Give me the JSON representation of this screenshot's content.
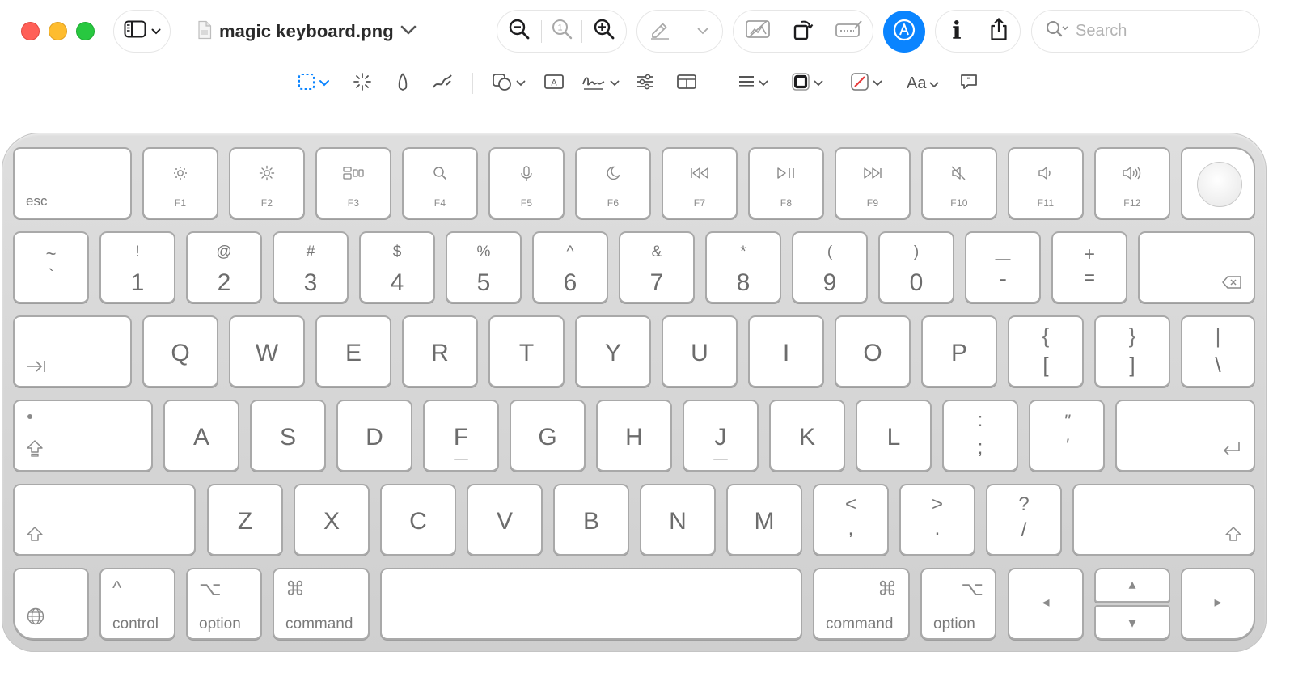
{
  "window": {
    "title": "magic keyboard.png"
  },
  "search": {
    "placeholder": "Search"
  },
  "colors": {
    "accent": "#0a84ff",
    "close": "#ff5f57",
    "minimize": "#febc2e",
    "zoom": "#28c840"
  },
  "toolbar": {
    "icons": [
      "sidebar-icon",
      "zoom-out-icon",
      "actual-size-icon",
      "zoom-in-icon",
      "highlight-icon",
      "crop-icon",
      "rotate-icon",
      "redact-icon",
      "markup-icon",
      "info-icon",
      "share-icon",
      "search-icon"
    ],
    "info_label": "i"
  },
  "markup_toolbar": {
    "icons": [
      "rect-selection-icon",
      "instant-alpha-icon",
      "sketch-icon",
      "draw-icon",
      "shapes-icon",
      "text-icon",
      "sign-icon",
      "adjust-color-icon",
      "page-layout-icon",
      "line-style-icon",
      "border-color-icon",
      "fill-color-icon",
      "text-style-icon",
      "note-icon"
    ],
    "text_style_label": "Aa"
  },
  "keyboard": {
    "fn_row": {
      "esc": "esc",
      "keys": [
        {
          "label": "F1",
          "icon": "brightness-down-icon"
        },
        {
          "label": "F2",
          "icon": "brightness-up-icon"
        },
        {
          "label": "F3",
          "icon": "mission-control-icon"
        },
        {
          "label": "F4",
          "icon": "spotlight-icon"
        },
        {
          "label": "F5",
          "icon": "dictation-icon"
        },
        {
          "label": "F6",
          "icon": "do-not-disturb-icon"
        },
        {
          "label": "F7",
          "icon": "rewind-icon"
        },
        {
          "label": "F8",
          "icon": "play-pause-icon"
        },
        {
          "label": "F9",
          "icon": "fast-forward-icon"
        },
        {
          "label": "F10",
          "icon": "mute-icon"
        },
        {
          "label": "F11",
          "icon": "volume-down-icon"
        },
        {
          "label": "F12",
          "icon": "volume-up-icon"
        }
      ]
    },
    "number_row": [
      {
        "top": "~",
        "bot": "`"
      },
      {
        "top": "!",
        "bot": "1"
      },
      {
        "top": "@",
        "bot": "2"
      },
      {
        "top": "#",
        "bot": "3"
      },
      {
        "top": "$",
        "bot": "4"
      },
      {
        "top": "%",
        "bot": "5"
      },
      {
        "top": "^",
        "bot": "6"
      },
      {
        "top": "&",
        "bot": "7"
      },
      {
        "top": "*",
        "bot": "8"
      },
      {
        "top": "(",
        "bot": "9"
      },
      {
        "top": ")",
        "bot": "0"
      },
      {
        "top": "—",
        "bot": "-"
      },
      {
        "top": "+",
        "bot": "="
      }
    ],
    "qwerty_row": [
      "Q",
      "W",
      "E",
      "R",
      "T",
      "Y",
      "U",
      "I",
      "O",
      "P"
    ],
    "bracket_keys": [
      {
        "top": "{",
        "bot": "["
      },
      {
        "top": "}",
        "bot": "]"
      },
      {
        "top": "|",
        "bot": "\\"
      }
    ],
    "home_row": [
      "A",
      "S",
      "D",
      "F",
      "G",
      "H",
      "J",
      "K",
      "L"
    ],
    "home_punct": [
      {
        "top": ":",
        "bot": ";"
      },
      {
        "top": "\"",
        "bot": "'"
      }
    ],
    "bottom_letters": [
      "Z",
      "X",
      "C",
      "V",
      "B",
      "N",
      "M"
    ],
    "bottom_punct": [
      {
        "top": "<",
        "bot": ","
      },
      {
        "top": ">",
        "bot": "."
      },
      {
        "top": "?",
        "bot": "/"
      }
    ],
    "modifiers": {
      "control": "control",
      "control_symbol": "^",
      "option": "option",
      "option_symbol": "⌥",
      "command": "command",
      "command_symbol": "⌘"
    },
    "arrows": {
      "left": "◂",
      "right": "▸",
      "up": "▴",
      "down": "▾"
    }
  }
}
